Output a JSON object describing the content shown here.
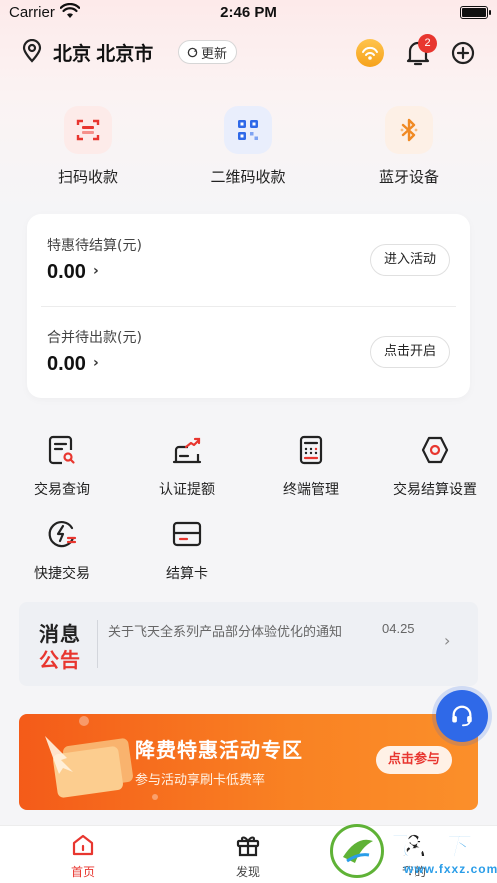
{
  "status_bar": {
    "carrier": "Carrier",
    "time": "2:46 PM"
  },
  "header": {
    "location": "北京 北京市",
    "refresh_label": "更新",
    "notification_count": "2"
  },
  "quick_actions": [
    {
      "label": "扫码收款",
      "icon": "scan-icon"
    },
    {
      "label": "二维码收款",
      "icon": "qr-code-icon"
    },
    {
      "label": "蓝牙设备",
      "icon": "bluetooth-icon"
    }
  ],
  "settlement_card": {
    "rows": [
      {
        "label": "特惠待结算(元)",
        "value": "0.00",
        "button": "进入活动"
      },
      {
        "label": "合并待出款(元)",
        "value": "0.00",
        "button": "点击开启"
      }
    ]
  },
  "function_grid": [
    {
      "label": "交易查询",
      "icon": "transaction-query-icon"
    },
    {
      "label": "认证提额",
      "icon": "limit-increase-icon"
    },
    {
      "label": "终端管理",
      "icon": "terminal-icon"
    },
    {
      "label": "交易结算设置",
      "icon": "settings-icon"
    },
    {
      "label": "快捷交易",
      "icon": "quick-trade-icon"
    },
    {
      "label": "结算卡",
      "icon": "card-icon"
    }
  ],
  "notice": {
    "title_line1": "消息",
    "title_line2": "公告",
    "text": "关于飞天全系列产品部分体验优化的通知",
    "date": "04.25"
  },
  "banner": {
    "title": "降费特惠活动专区",
    "subtitle": "参与活动享刷卡低费率",
    "button": "点击参与"
  },
  "tabbar": [
    {
      "label": "首页",
      "active": true
    },
    {
      "label": "发现",
      "active": false
    },
    {
      "label": "我的",
      "active": false
    }
  ],
  "watermark": {
    "text": "飞翔下载",
    "url": "www.fxxz.com"
  },
  "colors": {
    "accent": "#e8362f",
    "banner_orange": "#f45b19",
    "support_blue": "#2f69e8"
  }
}
